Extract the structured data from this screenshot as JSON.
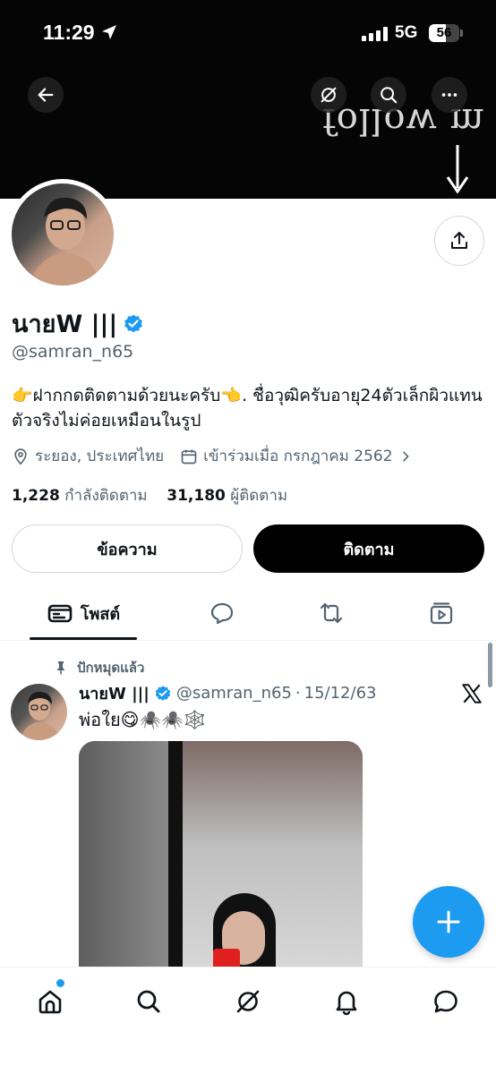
{
  "status_bar": {
    "time": "11:29",
    "network": "5G",
    "battery": "56",
    "battery_level": 0.56,
    "location_icon": "location-arrow-icon",
    "signal_icon": "signal-bars-icon"
  },
  "banner": {
    "text": "follow m"
  },
  "header": {
    "back_icon": "back-arrow-icon",
    "grok_icon": "grok-icon",
    "search_icon": "search-icon",
    "more_icon": "more-dots-icon",
    "share_icon": "share-icon"
  },
  "profile": {
    "name": "นายW |||",
    "handle": "@samran_n65",
    "bio": "👉ฝากกดติดตามด้วยนะครับ👈. ชื่อวุฒิครับอายุ24ตัวเล็กผิวแทน ตัวจริงไม่ค่อยเหมือนในรูป",
    "location": "ระยอง, ประเทศไทย",
    "joined": "เข้าร่วมเมื่อ กรกฎาคม 2562",
    "following_count": "1,228",
    "following_label": "กำลังติดตาม",
    "followers_count": "31,180",
    "followers_label": "ผู้ติดตาม",
    "verified_color": "#1d9bf0"
  },
  "actions": {
    "message_label": "ข้อความ",
    "follow_label": "ติดตาม"
  },
  "tabs": [
    {
      "label": "โพสต์",
      "icon": "posts-icon",
      "active": true
    },
    {
      "label": "",
      "icon": "replies-icon",
      "active": false
    },
    {
      "label": "",
      "icon": "reposts-icon",
      "active": false
    },
    {
      "label": "",
      "icon": "media-icon",
      "active": false
    }
  ],
  "pinned_post": {
    "pinned_label": "ปักหมุดแล้ว",
    "author_name": "นายW |||",
    "author_handle": "@samran_n65",
    "separator": "·",
    "date": "15/12/63",
    "text": "พ่อใย😋🕷️🕷️🕸️"
  },
  "bottom_nav": [
    {
      "icon": "home-icon",
      "active": true
    },
    {
      "icon": "search-icon"
    },
    {
      "icon": "grok-icon"
    },
    {
      "icon": "bell-icon"
    },
    {
      "icon": "chat-icon"
    }
  ],
  "colors": {
    "accent": "#1d9bf0",
    "text_primary": "#0f1419",
    "text_secondary": "#536471"
  }
}
